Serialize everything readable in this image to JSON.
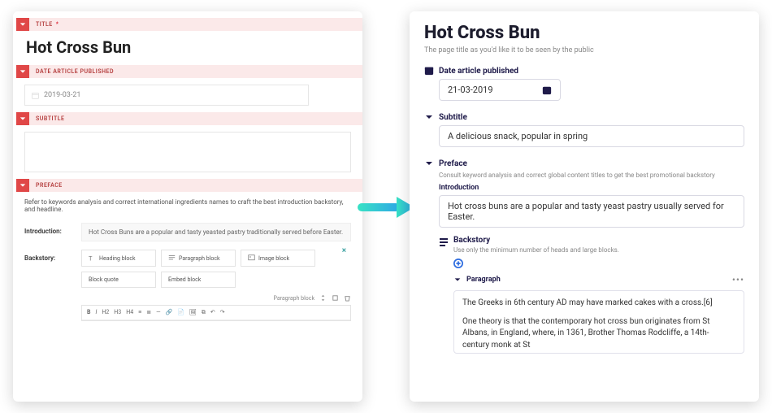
{
  "old": {
    "title_field_label": "TITLE",
    "title_value": "Hot Cross Bun",
    "date_label": "DATE ARTICLE PUBLISHED",
    "date_value": "2019-03-21",
    "subtitle_label": "SUBTITLE",
    "preface_label": "PREFACE",
    "preface_help": "Refer to keywords analysis and correct international ingredients names to craft the best introduction backstory, and headline.",
    "intro_label": "Introduction:",
    "intro_value": "Hot Cross Buns are a popular and tasty yeasted pastry traditionally served before Easter.",
    "backstory_label": "Backstory:",
    "blocks": {
      "heading": "Heading block",
      "paragraph": "Paragraph block",
      "image": "Image block",
      "blockquote": "Block quote",
      "embed": "Embed block"
    },
    "chooser_label": "Paragraph block",
    "rte": {
      "b": "B",
      "i": "I",
      "h2": "H2",
      "h3": "H3",
      "h4": "H4"
    }
  },
  "new": {
    "title_value": "Hot Cross Bun",
    "title_help": "The page title as you'd like it to be seen by the public",
    "date_label": "Date article published",
    "date_value": "21-03-2019",
    "subtitle_label": "Subtitle",
    "subtitle_value": "A delicious snack, popular in spring",
    "preface_label": "Preface",
    "preface_help": "Consult keyword analysis and correct global content titles to get the best promotional backstory",
    "intro_label": "Introduction",
    "intro_value": "Hot cross buns are a popular and tasty yeast pastry usually served for Easter.",
    "backstory_label": "Backstory",
    "backstory_help": "Use only the minimum number of heads and large blocks.",
    "paragraph_label": "Paragraph",
    "para1": "The Greeks in 6th century AD may have marked cakes with a cross.[6]",
    "para2": "One theory is that the contemporary hot cross bun originates from St Albans, in England, where, in 1361, Brother Thomas Rodcliffe, a 14th-century monk at St"
  }
}
